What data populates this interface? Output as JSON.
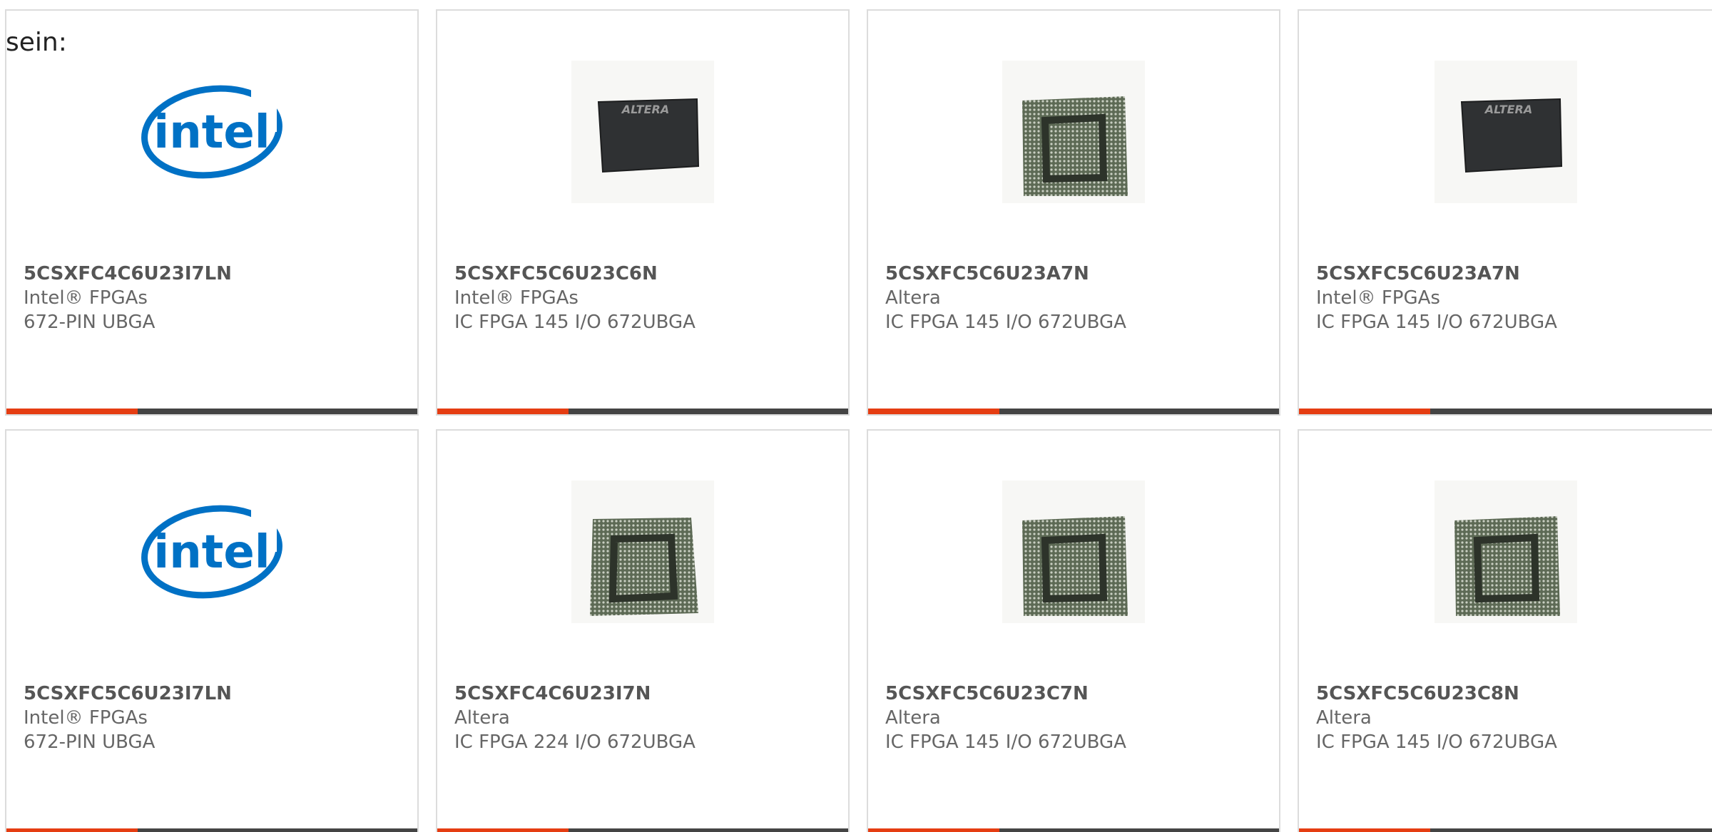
{
  "intro": {
    "text": "sein:"
  },
  "colors": {
    "accent": "#e53d12",
    "bar": "#444444",
    "border": "#dcdcdc",
    "intel_blue": "#0071c5"
  },
  "logo_text": "intel",
  "chip_marking": "ALTERA",
  "products": [
    {
      "part": "5CSXFC4C6U23I7LN",
      "maker": "Intel® FPGAs",
      "desc": "672-PIN UBGA",
      "image": "intel-logo"
    },
    {
      "part": "5CSXFC5C6U23C6N",
      "maker": "Intel® FPGAs",
      "desc": "IC FPGA 145 I/O 672UBGA",
      "image": "chip-top-icon"
    },
    {
      "part": "5CSXFC5C6U23A7N",
      "maker": "Altera",
      "desc": "IC FPGA 145 I/O 672UBGA",
      "image": "chip-bottom-icon"
    },
    {
      "part": "5CSXFC5C6U23A7N",
      "maker": "Intel® FPGAs",
      "desc": "IC FPGA 145 I/O 672UBGA",
      "image": "chip-top-icon"
    },
    {
      "part": "5CSXFC5C6U23I7LN",
      "maker": "Intel® FPGAs",
      "desc": "672-PIN UBGA",
      "image": "intel-logo"
    },
    {
      "part": "5CSXFC4C6U23I7N",
      "maker": "Altera",
      "desc": "IC FPGA 224 I/O 672UBGA",
      "image": "chip-bottom-icon"
    },
    {
      "part": "5CSXFC5C6U23C7N",
      "maker": "Altera",
      "desc": "IC FPGA 145 I/O 672UBGA",
      "image": "chip-bottom-icon"
    },
    {
      "part": "5CSXFC5C6U23C8N",
      "maker": "Altera",
      "desc": "IC FPGA 145 I/O 672UBGA",
      "image": "chip-bottom-icon"
    }
  ]
}
